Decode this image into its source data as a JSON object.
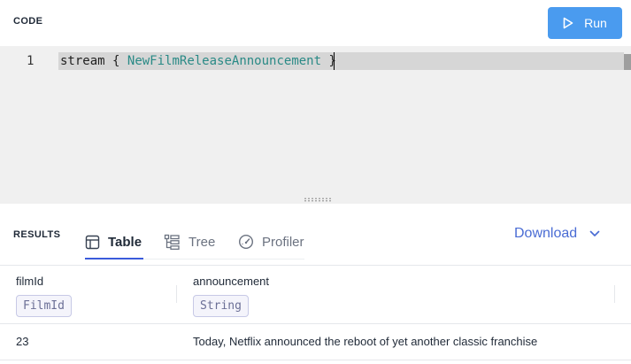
{
  "code_panel": {
    "title": "CODE",
    "run_label": "Run",
    "line_number": "1",
    "code": {
      "keyword": "stream",
      "open_brace": "{",
      "type_name": "NewFilmReleaseAnnouncement",
      "close_brace": "}"
    }
  },
  "results_panel": {
    "title": "RESULTS",
    "tabs": [
      {
        "label": "Table",
        "icon": "table-icon",
        "active": true
      },
      {
        "label": "Tree",
        "icon": "tree-icon",
        "active": false
      },
      {
        "label": "Profiler",
        "icon": "gauge-icon",
        "active": false
      }
    ],
    "download_label": "Download"
  },
  "table": {
    "columns": [
      {
        "name": "filmId",
        "type": "FilmId"
      },
      {
        "name": "announcement",
        "type": "String"
      }
    ],
    "rows": [
      [
        "23",
        "Today, Netflix announced the reboot of yet another classic franchise"
      ]
    ]
  },
  "colors": {
    "run_button": "#4a9bef",
    "active_tab_underline": "#3b5bdb",
    "download_link": "#4a6cd4",
    "type_token": "#2a8a86"
  }
}
